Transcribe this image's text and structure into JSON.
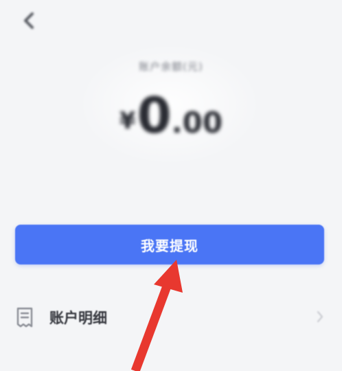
{
  "balance": {
    "label": "账户余额(元)",
    "currency_symbol": "¥",
    "amount_integer": "0",
    "amount_decimal": ".00"
  },
  "actions": {
    "withdraw_label": "我要提现"
  },
  "account_details": {
    "label": "账户明细"
  },
  "icons": {
    "back": "chevron-left-icon",
    "details": "document-icon",
    "row_arrow": "chevron-right-icon"
  },
  "colors": {
    "primary_button": "#4a75f5",
    "annotation_arrow": "#e8382f",
    "background": "#f4f5f7"
  }
}
